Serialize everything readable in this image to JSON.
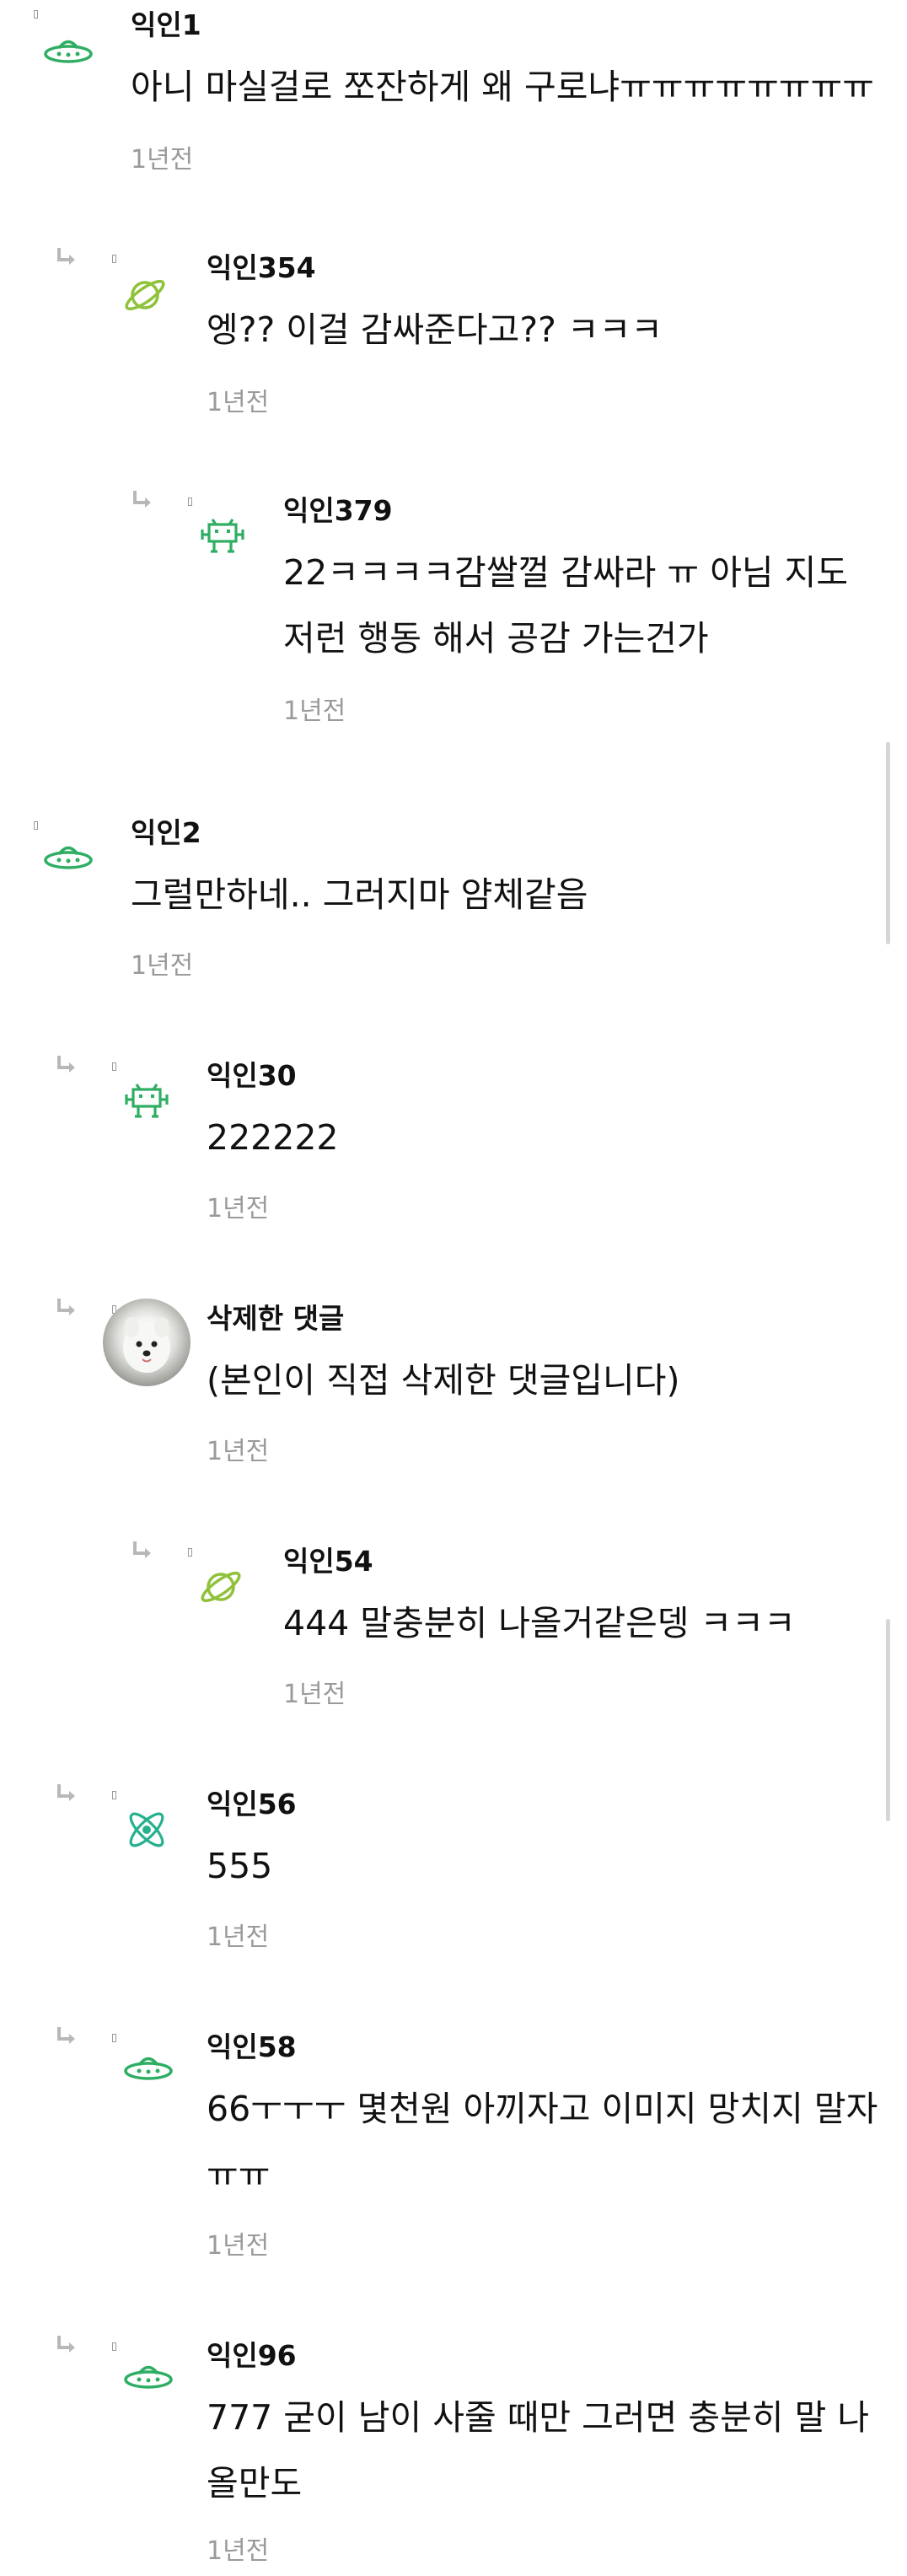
{
  "comments": [
    {
      "nick": "익인1",
      "text": "아니 마실걸로 쪼잔하게 왜 구로냐ㅠㅠㅠㅠㅠㅠㅠㅠ",
      "time": "1년전",
      "avatar": "ufo-icon"
    },
    {
      "nick": "익인354",
      "text": "엥?? 이걸 감싸준다고?? ㅋㅋㅋ",
      "time": "1년전",
      "avatar": "planet-icon"
    },
    {
      "nick": "익인379",
      "text": "22ㅋㅋㅋㅋ감쌀껄 감싸라 ㅠ 아님 지도\n저런 행동 해서 공감 가는건가",
      "time": "1년전",
      "avatar": "space-invader-icon"
    },
    {
      "nick": "익인2",
      "text": "그럴만하네.. 그러지마 얌체같음",
      "time": "1년전",
      "avatar": "ufo-icon"
    },
    {
      "nick": "익인30",
      "text": "222222",
      "time": "1년전",
      "avatar": "space-invader-icon"
    },
    {
      "nick": "삭제한 댓글",
      "text": "(본인이 직접 삭제한 댓글입니다)",
      "time": "1년전",
      "avatar": "dog-photo-avatar"
    },
    {
      "nick": "익인54",
      "text": "444 말충분히 나올거같은뎅 ㅋㅋㅋ",
      "time": "1년전",
      "avatar": "planet-icon"
    },
    {
      "nick": "익인56",
      "text": "555",
      "time": "1년전",
      "avatar": "atom-icon"
    },
    {
      "nick": "익인58",
      "text": "66ㅜㅜㅜ 몇천원 아끼자고 이미지 망치지 말자\nㅠㅠ",
      "time": "1년전",
      "avatar": "ufo-icon"
    },
    {
      "nick": "익인96",
      "text": "777 굳이 남이 사줄 때만 그러면 충분히 말 나\n올만도",
      "time": "1년전",
      "avatar": "ufo-icon"
    }
  ],
  "colors": {
    "avatar_green": "#2fae63",
    "planet_green": "#8fc23a",
    "atom_teal": "#27b08e",
    "time_gray": "#9a9a9a",
    "divider": "#e4e4e4"
  }
}
